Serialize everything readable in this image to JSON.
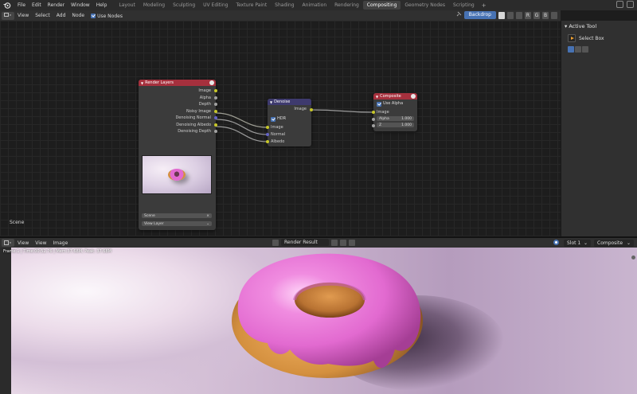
{
  "topbar": {
    "menus": [
      "File",
      "Edit",
      "Render",
      "Window",
      "Help"
    ],
    "workspaces": [
      "Layout",
      "Modeling",
      "Sculpting",
      "UV Editing",
      "Texture Paint",
      "Shading",
      "Animation",
      "Rendering",
      "Compositing",
      "Geometry Nodes",
      "Scripting"
    ],
    "active_workspace": "Compositing",
    "add_symbol": "+"
  },
  "node_header": {
    "menus": [
      "View",
      "Select",
      "Add",
      "Node"
    ],
    "use_nodes_label": "Use Nodes",
    "backdrop_label": "Backdrop",
    "channels": [
      "R",
      "G",
      "B"
    ]
  },
  "nodes": {
    "render_layers": {
      "title": "Render Layers",
      "outputs": [
        "Image",
        "Alpha",
        "Depth",
        "Noisy Image",
        "Denoising Normal",
        "Denoising Albedo",
        "Denoising Depth"
      ],
      "scene_value": "Scene",
      "layer_value": "View Layer"
    },
    "denoise": {
      "title": "Denoise",
      "output": "Image",
      "hdr_label": "HDR",
      "inputs": [
        "Image",
        "Normal",
        "Albedo"
      ]
    },
    "composite": {
      "title": "Composite",
      "use_alpha_label": "Use Alpha",
      "input": "Image",
      "alpha_label": "Alpha",
      "alpha_value": "1.000",
      "z_label": "Z",
      "z_value": "1.000"
    }
  },
  "canvas": {
    "scene_label": "Scene"
  },
  "sidebar": {
    "title": "Active Tool",
    "tool_name": "Select Box"
  },
  "image_editor": {
    "menus": [
      "View",
      "View",
      "Image"
    ],
    "image_name": "Render Result",
    "slot": "Slot 1",
    "layer": "Composite",
    "frame_info": "Frame:1 | Time:00:52.76 | Mem:37.68M, Peak: 37.68M"
  },
  "colors": {
    "render_layers_header": "#a5303d",
    "denoise_header": "#3e3a6e",
    "composite_header": "#a5303d",
    "accent": "#4772b3",
    "socket_color": "#c7c729",
    "socket_vector": "#6363c7",
    "socket_float": "#a1a1a1",
    "donut_icing": "#e26ad0",
    "donut_dough": "#d4903f"
  }
}
